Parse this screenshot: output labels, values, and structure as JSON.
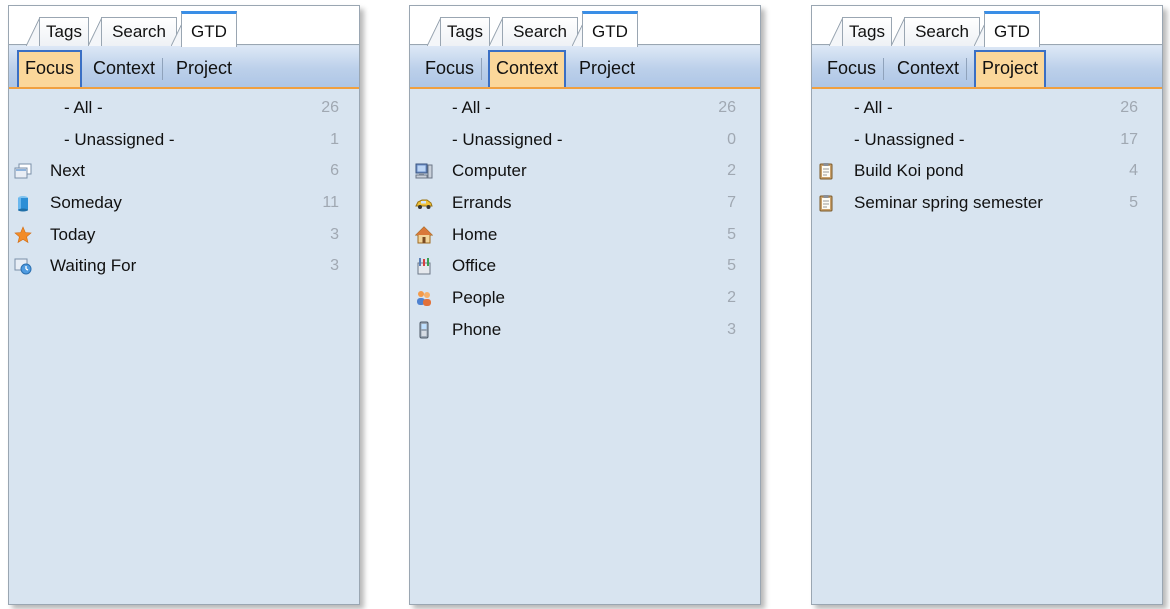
{
  "top_tabs": [
    "Tags",
    "Search",
    "GTD"
  ],
  "sub_tabs": [
    "Focus",
    "Context",
    "Project"
  ],
  "panels": [
    {
      "active_sub_tab": "Focus",
      "rows": [
        {
          "label": "- All -",
          "count": "26",
          "icon": "none"
        },
        {
          "label": "- Unassigned -",
          "count": "1",
          "icon": "none"
        },
        {
          "label": "Next",
          "count": "6",
          "icon": "next-icon"
        },
        {
          "label": "Someday",
          "count": "11",
          "icon": "someday-icon"
        },
        {
          "label": "Today",
          "count": "3",
          "icon": "star-icon"
        },
        {
          "label": "Waiting For",
          "count": "3",
          "icon": "waiting-for-icon"
        }
      ]
    },
    {
      "active_sub_tab": "Context",
      "rows": [
        {
          "label": "- All -",
          "count": "26",
          "icon": "none"
        },
        {
          "label": "- Unassigned -",
          "count": "0",
          "icon": "none"
        },
        {
          "label": "Computer",
          "count": "2",
          "icon": "computer-icon"
        },
        {
          "label": "Errands",
          "count": "7",
          "icon": "car-icon"
        },
        {
          "label": "Home",
          "count": "5",
          "icon": "home-icon"
        },
        {
          "label": "Office",
          "count": "5",
          "icon": "office-icon"
        },
        {
          "label": "People",
          "count": "2",
          "icon": "people-icon"
        },
        {
          "label": "Phone",
          "count": "3",
          "icon": "phone-icon"
        }
      ]
    },
    {
      "active_sub_tab": "Project",
      "rows": [
        {
          "label": "- All -",
          "count": "26",
          "icon": "none"
        },
        {
          "label": "- Unassigned -",
          "count": "17",
          "icon": "none"
        },
        {
          "label": "Build Koi pond",
          "count": "4",
          "icon": "clipboard-icon"
        },
        {
          "label": "Seminar spring semester",
          "count": "5",
          "icon": "clipboard-icon"
        }
      ]
    }
  ]
}
